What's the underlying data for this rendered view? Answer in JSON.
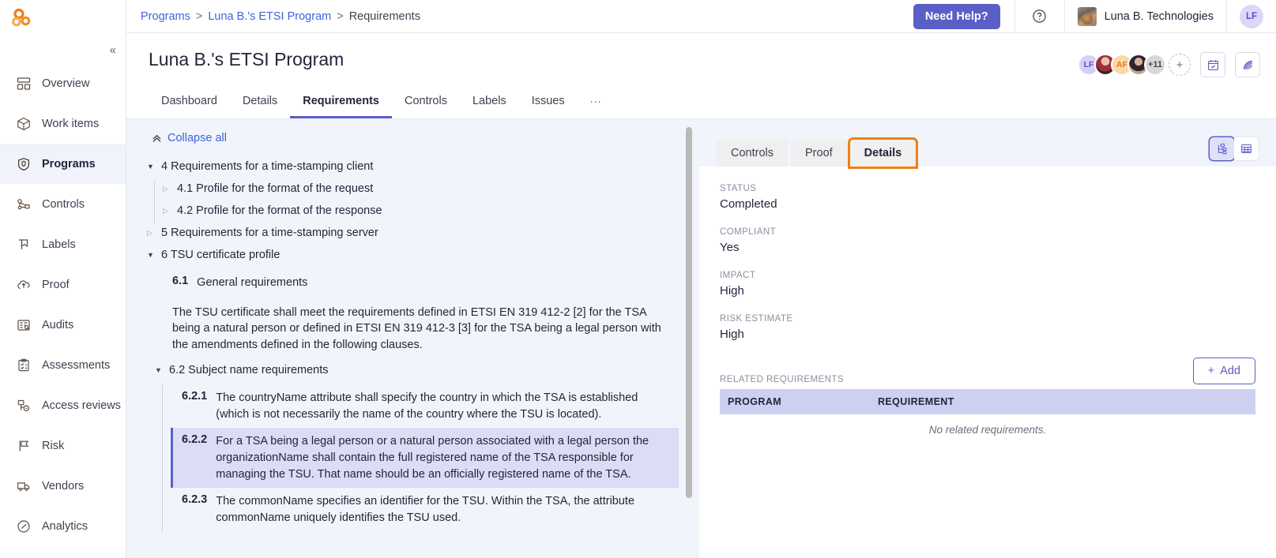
{
  "brand": {
    "logo_name": "three-rings-logo",
    "accent": "#5a5fc7",
    "logo_color": "#ef8b23"
  },
  "sidebar": {
    "collapse_label": "«",
    "items": [
      {
        "label": "Overview",
        "icon": "dashboard-icon",
        "active": false
      },
      {
        "label": "Work items",
        "icon": "box-icon",
        "active": false
      },
      {
        "label": "Programs",
        "icon": "shield-icon",
        "active": true
      },
      {
        "label": "Controls",
        "icon": "node-tree-icon",
        "active": false
      },
      {
        "label": "Labels",
        "icon": "bookmark-icon",
        "active": false
      },
      {
        "label": "Proof",
        "icon": "cloud-upload-icon",
        "active": false
      },
      {
        "label": "Audits",
        "icon": "audit-list-icon",
        "active": false
      },
      {
        "label": "Assessments",
        "icon": "clipboard-check-icon",
        "active": false
      },
      {
        "label": "Access reviews",
        "icon": "access-key-icon",
        "active": false
      },
      {
        "label": "Risk",
        "icon": "flag-icon",
        "active": false
      },
      {
        "label": "Vendors",
        "icon": "truck-icon",
        "active": false
      },
      {
        "label": "Analytics",
        "icon": "gauge-icon",
        "active": false
      }
    ]
  },
  "topbar": {
    "breadcrumb": [
      {
        "label": "Programs",
        "link": true
      },
      {
        "label": "Luna B.'s ETSI Program",
        "link": true
      },
      {
        "label": "Requirements",
        "link": false
      }
    ],
    "separator": ">",
    "need_help_label": "Need Help?",
    "help_icon": "question-circle-icon",
    "org_name": "Luna B. Technologies",
    "org_avatar": "dog-photo-avatar",
    "user_initials": "LF"
  },
  "page": {
    "title": "Luna B.'s ETSI Program",
    "avatars": [
      {
        "type": "initials",
        "label": "LF"
      },
      {
        "type": "photo",
        "label": ""
      },
      {
        "type": "initials",
        "label": "AF"
      },
      {
        "type": "photo",
        "label": ""
      },
      {
        "type": "count",
        "label": "+11"
      }
    ],
    "add_member_label": "+",
    "actions": [
      {
        "icon": "calendar-check-icon"
      },
      {
        "icon": "rss-feed-icon"
      }
    ],
    "tabs": [
      {
        "label": "Dashboard",
        "active": false
      },
      {
        "label": "Details",
        "active": false
      },
      {
        "label": "Requirements",
        "active": true
      },
      {
        "label": "Controls",
        "active": false
      },
      {
        "label": "Labels",
        "active": false
      },
      {
        "label": "Issues",
        "active": false
      },
      {
        "label": "...",
        "active": false
      }
    ]
  },
  "requirements": {
    "collapse_all_label": "Collapse all",
    "collapse_all_icon": "chevrons-up-icon",
    "tree": [
      {
        "id": "4",
        "label": "4 Requirements for a time-stamping client",
        "expanded": true
      },
      {
        "id": "4.1",
        "label": "4.1 Profile for the format of the request",
        "expanded": false
      },
      {
        "id": "4.2",
        "label": "4.2 Profile for the format of the response",
        "expanded": false
      },
      {
        "id": "5",
        "label": "5 Requirements for a time-stamping server",
        "expanded": false
      },
      {
        "id": "6",
        "label": "6 TSU certificate profile",
        "expanded": true
      },
      {
        "id": "6.1",
        "label": "General requirements",
        "number": "6.1"
      },
      {
        "id": "6.2",
        "label": "6.2 Subject name requirements",
        "expanded": true
      }
    ],
    "paragraph_6_1": "The TSU certificate shall meet the requirements defined in ETSI EN 319 412-2 [2] for the TSA being a natural person or defined in ETSI EN 319 412-3 [3] for the TSA being a legal person with the amendments defined in the following clauses.",
    "leaves": [
      {
        "number": "6.2.1",
        "text": "The countryName attribute shall specify the country in which the TSA is established (which is not necessarily the name of the country where the TSU is located).",
        "selected": false
      },
      {
        "number": "6.2.2",
        "text": "For a TSA being a legal person or a natural person associated with a legal person the organizationName shall contain the full registered name of the TSA responsible for managing the TSU. That name should be an officially registered name of the TSA.",
        "selected": true
      },
      {
        "number": "6.2.3",
        "text": "The commonName specifies an identifier for the TSU. Within the TSA, the attribute commonName uniquely identifies the TSU used.",
        "selected": false
      }
    ]
  },
  "details": {
    "tabs": [
      {
        "label": "Controls",
        "active": false,
        "highlighted": false
      },
      {
        "label": "Proof",
        "active": false,
        "highlighted": false
      },
      {
        "label": "Details",
        "active": true,
        "highlighted": true
      }
    ],
    "view_toggle": [
      {
        "icon": "tree-view-icon",
        "active": true
      },
      {
        "icon": "table-view-icon",
        "active": false
      }
    ],
    "fields": [
      {
        "label": "STATUS",
        "value": "Completed"
      },
      {
        "label": "COMPLIANT",
        "value": "Yes"
      },
      {
        "label": "IMPACT",
        "value": "High"
      },
      {
        "label": "RISK ESTIMATE",
        "value": "High"
      }
    ],
    "related": {
      "label": "RELATED REQUIREMENTS",
      "add_label": "Add",
      "add_icon": "plus-icon",
      "columns": [
        "PROGRAM",
        "REQUIREMENT"
      ],
      "rows": [],
      "empty_text": "No related requirements."
    }
  }
}
